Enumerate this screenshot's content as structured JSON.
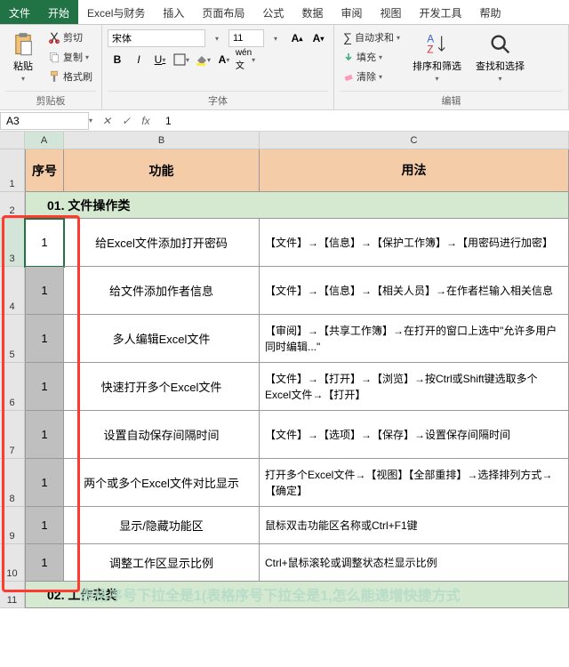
{
  "menubar": {
    "tabs": [
      "文件",
      "开始",
      "Excel与财务",
      "插入",
      "页面布局",
      "公式",
      "数据",
      "审阅",
      "视图",
      "开发工具",
      "帮助"
    ],
    "active_index": 1
  },
  "ribbon": {
    "clipboard": {
      "paste": "粘贴",
      "cut": "剪切",
      "copy": "复制",
      "painter": "格式刷",
      "group": "剪贴板"
    },
    "font": {
      "name": "宋体",
      "size": "11",
      "group": "字体",
      "bold": "B",
      "italic": "I",
      "underline": "U"
    },
    "alignment": {
      "autosum": "自动求和",
      "fill": "填充",
      "clear": "清除",
      "group": "编辑",
      "sort": "排序和筛选",
      "findsel": "查找和选择"
    }
  },
  "namebox": "A3",
  "formula": "1",
  "grid": {
    "cols": [
      "A",
      "B",
      "C"
    ],
    "header": {
      "a": "序号",
      "b": "功能",
      "c": "用法"
    },
    "sections": {
      "s1": "01. 文件操作类",
      "s2": "02. 工作表类"
    },
    "rows": [
      {
        "a": "1",
        "b": "给Excel文件添加打开密码",
        "c": "【文件】→【信息】→【保护工作簿】→【用密码进行加密】"
      },
      {
        "a": "1",
        "b": "给文件添加作者信息",
        "c": "【文件】→【信息】→【相关人员】→在作者栏输入相关信息"
      },
      {
        "a": "1",
        "b": "多人编辑Excel文件",
        "c": "【审阅】→【共享工作簿】→在打开的窗口上选中\"允许多用户同时编辑...\""
      },
      {
        "a": "1",
        "b": "快速打开多个Excel文件",
        "c": "【文件】→【打开】→【浏览】→按Ctrl或Shift键选取多个Excel文件→【打开】"
      },
      {
        "a": "1",
        "b": "设置自动保存间隔时间",
        "c": "【文件】→【选项】→【保存】→设置保存间隔时间"
      },
      {
        "a": "1",
        "b": "两个或多个Excel文件对比显示",
        "c": "打开多个Excel文件→【视图】【全部重排】→选择排列方式→【确定】"
      },
      {
        "a": "1",
        "b": "显示/隐藏功能区",
        "c": "鼠标双击功能区名称或Ctrl+F1键"
      },
      {
        "a": "1",
        "b": "调整工作区显示比例",
        "c": "Ctrl+鼠标滚轮或调整状态栏显示比例"
      }
    ]
  },
  "watermark": "表格序号下拉全是1(表格序号下拉全是1,怎么能递增快捷方式"
}
